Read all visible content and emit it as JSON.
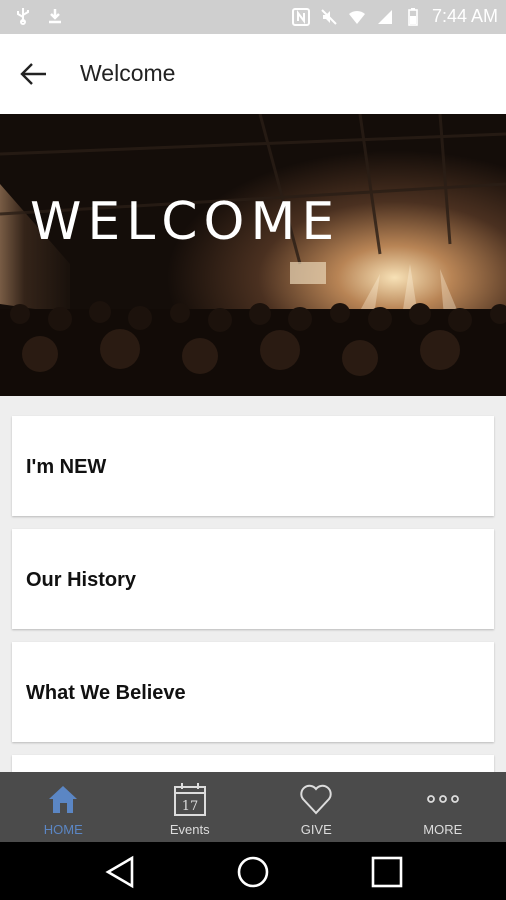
{
  "status_bar": {
    "time": "7:44 AM"
  },
  "app_bar": {
    "title": "Welcome"
  },
  "hero": {
    "title": "WELCOME"
  },
  "items": [
    {
      "label": "I'm NEW"
    },
    {
      "label": "Our History"
    },
    {
      "label": "What We Believe"
    }
  ],
  "tabs": [
    {
      "label": "HOME",
      "icon": "home-icon",
      "active": true
    },
    {
      "label": "Events",
      "icon": "calendar-icon",
      "calendar_day": "17"
    },
    {
      "label": "GIVE",
      "icon": "heart-icon"
    },
    {
      "label": "MORE",
      "icon": "more-dots-icon"
    }
  ],
  "colors": {
    "accent": "#5b86c4",
    "tabbar": "#4b4b4b",
    "status_bar": "#cfcfcf"
  }
}
